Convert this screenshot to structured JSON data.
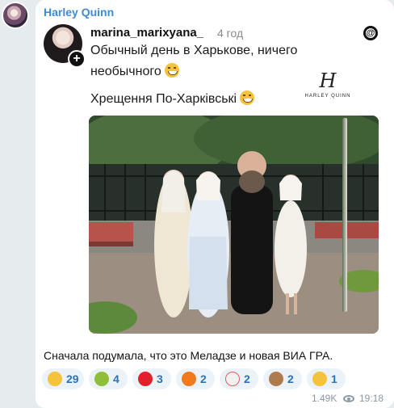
{
  "channel": {
    "sender": "Harley Quinn"
  },
  "embed": {
    "username": "marina_marixyana_",
    "age": "4 год",
    "line1": "Обычный день в Харькове, ничего",
    "line2": "необычного",
    "line3": "Хрещення По-Харківські",
    "brand": {
      "mark": "H",
      "text": "HARLEY QUINN"
    }
  },
  "caption": "Сначала подумала, что это Меладзе и новая ВИА ГРА.",
  "reactions": [
    {
      "emoji": "grinning-squinting-face",
      "count": "29",
      "color": "#f5c33b"
    },
    {
      "emoji": "nauseated-face",
      "count": "4",
      "color": "#8fbf39"
    },
    {
      "emoji": "red-heart",
      "count": "3",
      "color": "#e0202a"
    },
    {
      "emoji": "fire",
      "count": "2",
      "color": "#f27a1a"
    },
    {
      "emoji": "clown-face",
      "count": "2",
      "color": "#f2f2f2"
    },
    {
      "emoji": "see-no-evil-monkey",
      "count": "2",
      "color": "#b07b4c"
    },
    {
      "emoji": "thumbs-up",
      "count": "1",
      "color": "#f5c33b"
    }
  ],
  "footer": {
    "views": "1.49K",
    "time": "19:18"
  }
}
